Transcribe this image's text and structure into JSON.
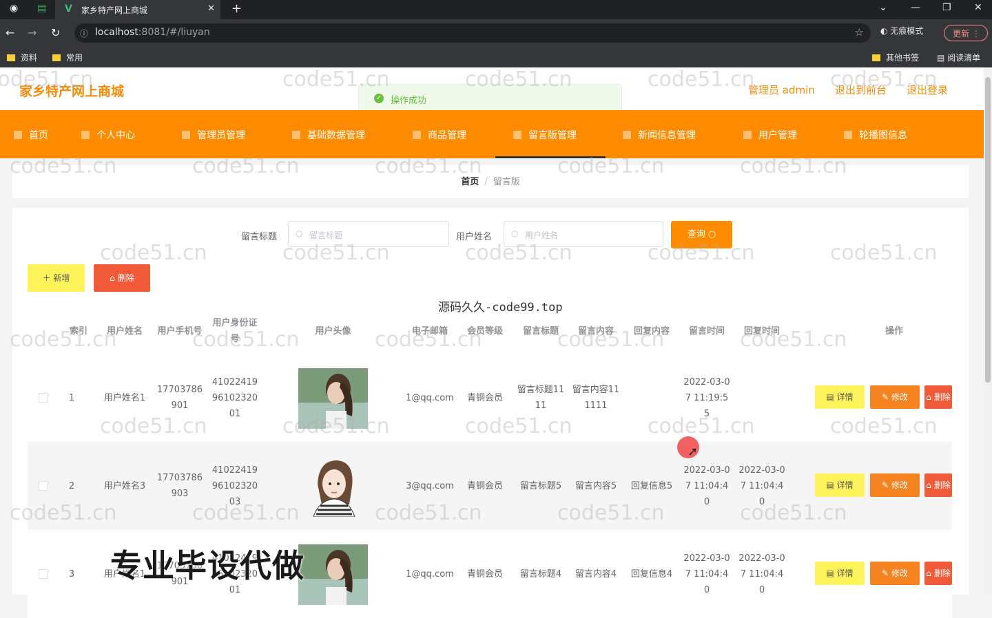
{
  "browser": {
    "tab_title": "家乡特产网上商城",
    "url_host": "localhost",
    "url_rest": ":8081/#/liuyan",
    "incognito_label": "无痕模式",
    "update_label": "更新",
    "bookmarks": [
      "资料",
      "常用"
    ],
    "bookmarks_right": [
      "其他书签",
      "阅读清单"
    ]
  },
  "header": {
    "brand": "家乡特产网上商城",
    "user": "管理员 admin",
    "back_front": "退出到前台",
    "logout": "退出登录"
  },
  "toast": {
    "message": "操作成功"
  },
  "nav": {
    "items": [
      "首页",
      "个人中心",
      "管理员管理",
      "基础数据管理",
      "商品管理",
      "留言版管理",
      "新闻信息管理",
      "用户管理",
      "轮播图信息"
    ],
    "active_index": 5
  },
  "breadcrumb": {
    "home": "首页",
    "current": "留言版"
  },
  "search": {
    "title_label": "留言标题",
    "title_placeholder": "留言标题",
    "name_label": "用户姓名",
    "name_placeholder": "用户姓名",
    "query_button": "查询"
  },
  "actions": {
    "add": "新增",
    "delete": "删除"
  },
  "overlay_text": "源码久久-code99.top",
  "table": {
    "headers": {
      "index": "索引",
      "name": "用户姓名",
      "phone": "用户手机号",
      "idcard": "用户身份证号",
      "avatar": "用户头像",
      "email": "电子邮箱",
      "level": "会员等级",
      "title": "留言标题",
      "content": "留言内容",
      "reply": "回复内容",
      "msg_time": "留言时间",
      "reply_time": "回复时间",
      "ops": "操作"
    },
    "rows": [
      {
        "index": "1",
        "name": "用户姓名1",
        "phone": "17703786901",
        "idcard": "410224199610232001",
        "email": "1@qq.com",
        "level": "青铜会员",
        "title": "留言标题1111",
        "content": "留言内容111111",
        "reply": "",
        "msg_time": "2022-03-07 11:19:55",
        "reply_time": ""
      },
      {
        "index": "2",
        "name": "用户姓名3",
        "phone": "17703786903",
        "idcard": "410224199610232003",
        "email": "3@qq.com",
        "level": "青铜会员",
        "title": "留言标题5",
        "content": "留言内容5",
        "reply": "回复信息5",
        "msg_time": "2022-03-07 11:04:40",
        "reply_time": "2022-03-07 11:04:40"
      },
      {
        "index": "3",
        "name": "用户姓名1",
        "phone": "17703786901",
        "idcard": "410224199610232001",
        "email": "1@qq.com",
        "level": "青铜会员",
        "title": "留言标题4",
        "content": "留言内容4",
        "reply": "回复信息4",
        "msg_time": "2022-03-07 11:04:40",
        "reply_time": "2022-03-07 11:04:40"
      }
    ],
    "row_buttons": {
      "detail": "详情",
      "edit": "修改",
      "remove": "删除"
    }
  },
  "watermark": {
    "text": "code51.cn",
    "overlay": "专业毕设代做"
  },
  "colors": {
    "accent": "#ff8c00",
    "brand_text": "#f68b0a",
    "add_button": "#fff35c",
    "delete_button": "#f05a39",
    "success": "#67c23a"
  }
}
